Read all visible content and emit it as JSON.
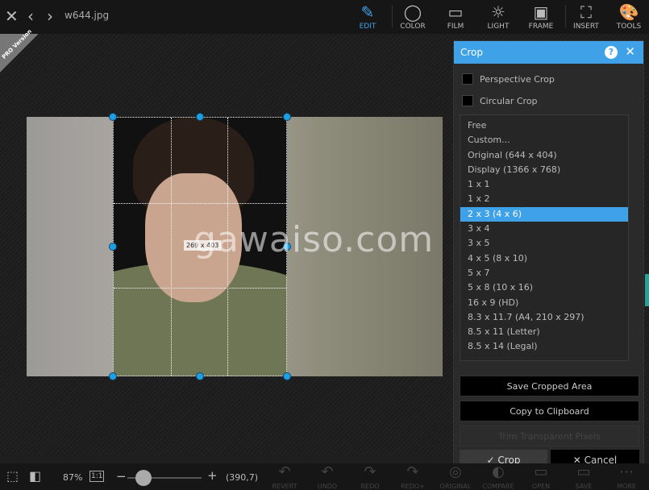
{
  "header": {
    "filename": "w644.jpg",
    "tools": [
      {
        "label": "EDIT",
        "icon": "edit-icon",
        "active": true
      },
      {
        "label": "COLOR",
        "icon": "color-icon"
      },
      {
        "label": "FILM",
        "icon": "film-icon"
      },
      {
        "label": "LIGHT",
        "icon": "light-icon"
      },
      {
        "label": "FRAME",
        "icon": "frame-icon"
      },
      {
        "label": "INSERT",
        "icon": "insert-icon"
      },
      {
        "label": "TOOLS",
        "icon": "tools-icon"
      }
    ]
  },
  "badge": {
    "text": "PRO Version"
  },
  "canvas": {
    "crop_size": "269 x 403",
    "watermark": "gawaiso.com"
  },
  "crop_panel": {
    "title": "Crop",
    "perspective": "Perspective Crop",
    "circular": "Circular Crop",
    "ratios": [
      "Free",
      "Custom...",
      "Original (644 x 404)",
      "Display (1366 x 768)",
      "1 x 1",
      "1 x 2",
      "2 x 3 (4 x 6)",
      "3 x 4",
      "3 x 5",
      "4 x 5 (8 x 10)",
      "5 x 7",
      "5 x 8 (10 x 16)",
      "16 x 9 (HD)",
      "8.3 x 11.7 (A4, 210 x 297)",
      "8.5 x 11 (Letter)",
      "8.5 x 14 (Legal)"
    ],
    "selected": "2 x 3 (4 x 6)",
    "save": "Save Cropped Area",
    "copy": "Copy to Clipboard",
    "trim": "Trim Transparent Pixels",
    "ok": "Crop",
    "cancel": "Cancel"
  },
  "footer": {
    "zoom": "87%",
    "one_to_one": "1:1",
    "minus": "−",
    "plus": "+",
    "coords": "(390,7)",
    "zoom_slider_fraction": 0.1,
    "actions": [
      "REVERT",
      "UNDO",
      "REDO",
      "REDO+",
      "ORIGINAL",
      "COMPARE",
      "OPEN",
      "SAVE",
      "MORE"
    ]
  },
  "colors": {
    "accent": "#3fa2e8",
    "handle": "#1ea0e0"
  }
}
